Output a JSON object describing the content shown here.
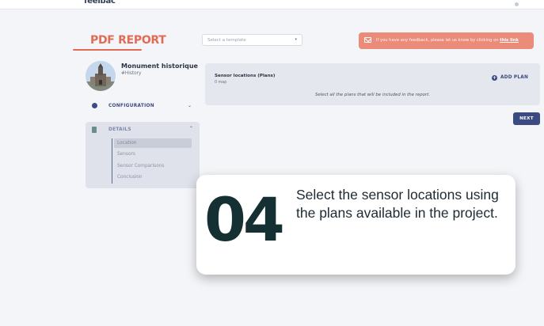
{
  "header": {
    "brand": "feelbac"
  },
  "page": {
    "title": "PDF REPORT"
  },
  "template_select": {
    "placeholder": "Select a template",
    "chevron": "▾"
  },
  "feedback_banner": {
    "text": "If you have any feedback, please let us know by clicking on",
    "link": "this link"
  },
  "project": {
    "name": "Monument historique",
    "tag": "#History"
  },
  "sidebar": {
    "configuration": {
      "label": "CONFIGURATION",
      "chevron": "⌄"
    },
    "details": {
      "label": "DETAILS",
      "chevron": "⌃",
      "items": [
        {
          "label": "Location",
          "active": true
        },
        {
          "label": "Sensors",
          "active": false
        },
        {
          "label": "Sensor Comparisons",
          "active": false
        },
        {
          "label": "Conclusion",
          "active": false
        }
      ]
    }
  },
  "plans": {
    "title": "Sensor locations (Plans)",
    "count": "0 map",
    "description": "Select all the plans that will be included in the report.",
    "add_label": "ADD PLAN",
    "add_icon": "+"
  },
  "next_label": "NEXT",
  "callout": {
    "number": "04",
    "text": "Select the sensor locations using the plans available in the project."
  },
  "colors": {
    "accent": "#e36b55",
    "primary": "#3b4a80",
    "feedback_bg": "#eb8c7a",
    "step_number": "#143032"
  }
}
